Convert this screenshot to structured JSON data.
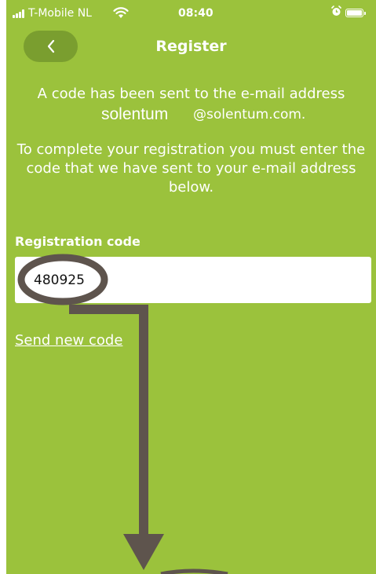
{
  "status_bar": {
    "carrier": "T-Mobile NL",
    "time": "08:40",
    "wifi_icon": "wifi-icon",
    "alarm_icon": "alarm-icon",
    "battery_icon": "battery-icon"
  },
  "header": {
    "title": "Register",
    "back_icon": "chevron-left-icon"
  },
  "info": {
    "sent_text": "A code has been sent to the e-mail address",
    "email_user": "solentum",
    "email_domain": "@solentum.com.",
    "instructions": "To complete your registration you must enter the code that we have sent to your e-mail address below."
  },
  "form": {
    "code_label": "Registration code",
    "code_value": "480925",
    "send_new_code": "Send new code"
  },
  "colors": {
    "background": "#9bc23c",
    "back_button": "#7a9e2f",
    "annotation": "#5e544d",
    "text": "#ffffff"
  }
}
